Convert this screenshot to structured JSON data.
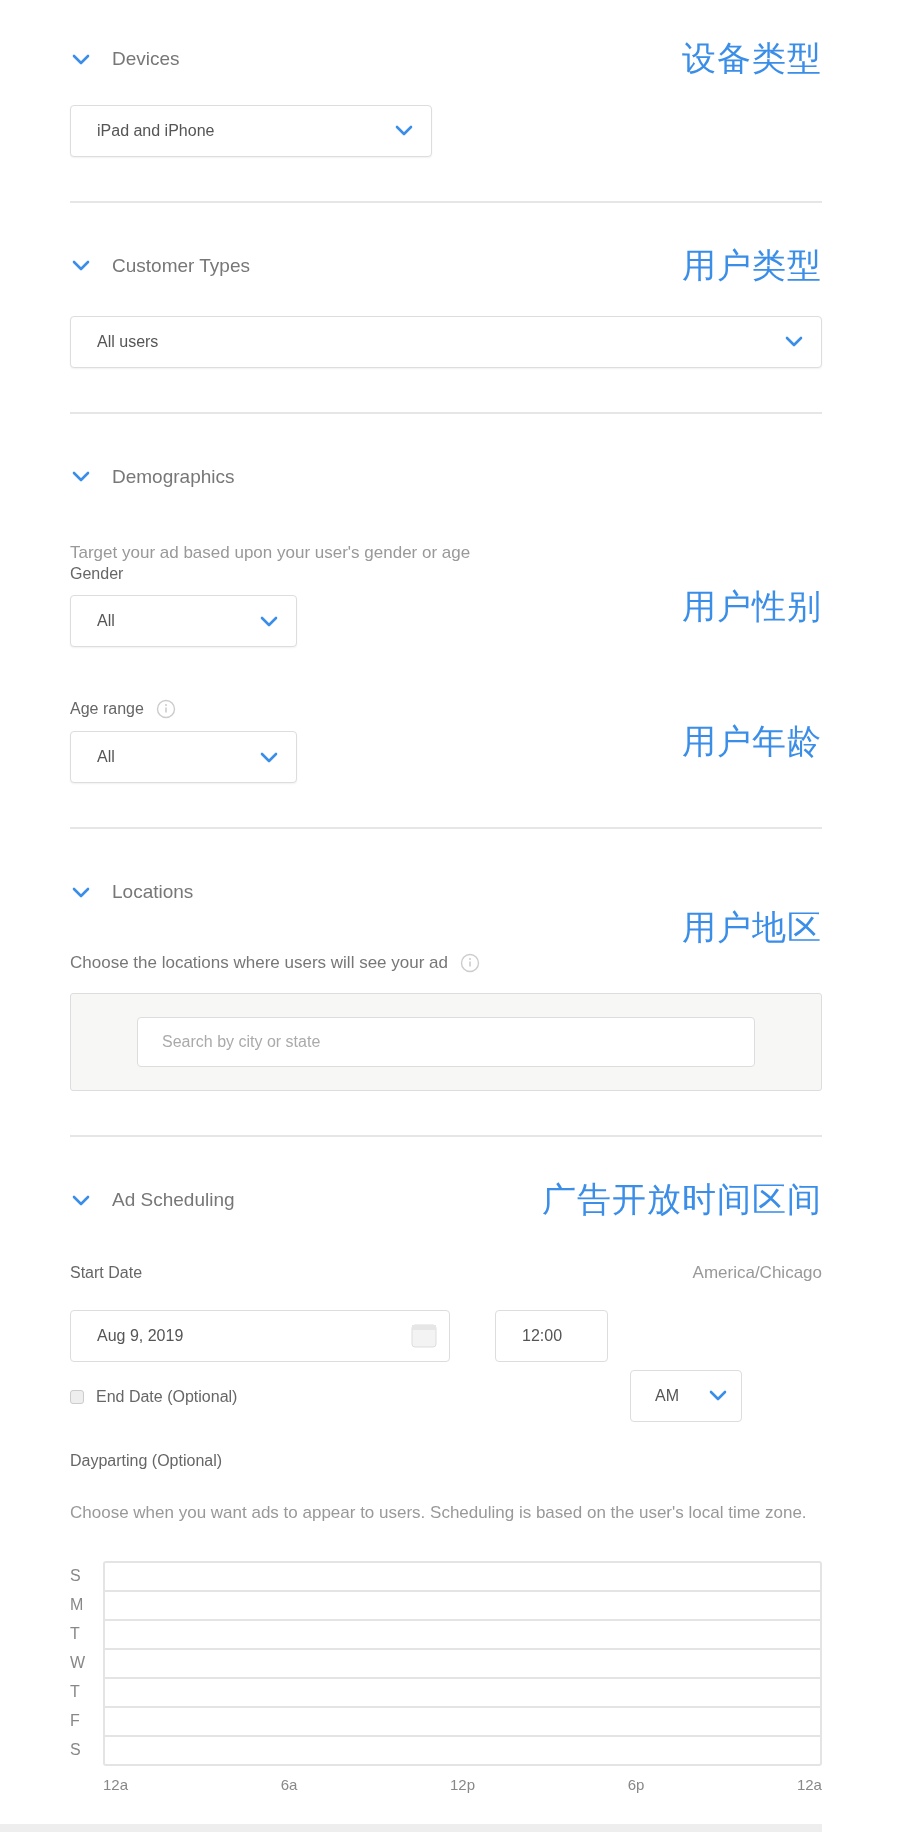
{
  "sections": [
    {
      "kind": "devices",
      "title": "Devices",
      "expanded": true,
      "annotation": "设备类型",
      "select": {
        "value": "iPad and iPhone"
      }
    },
    {
      "kind": "customer_types",
      "title": "Customer Types",
      "expanded": true,
      "annotation": "用户类型",
      "select": {
        "value": "All users"
      }
    },
    {
      "kind": "demographics",
      "title": "Demographics",
      "expanded": true,
      "description": "Target your ad based upon your user's gender or age",
      "gender": {
        "label": "Gender",
        "value": "All",
        "annotation": "用户性别"
      },
      "age": {
        "label": "Age range",
        "value": "All",
        "annotation": "用户年龄"
      }
    },
    {
      "kind": "locations",
      "title": "Locations",
      "expanded": true,
      "annotation": "用户地区",
      "description": "Choose the locations where users will see your ad",
      "search": {
        "placeholder": "Search by city or state"
      }
    },
    {
      "kind": "scheduling",
      "title": "Ad Scheduling",
      "expanded": true,
      "annotation": "广告开放时间区间",
      "start_label": "Start Date",
      "timezone": "America/Chicago",
      "date": "Aug 9, 2019",
      "time": "12:00",
      "meridiem": "AM",
      "end_date": {
        "label": "End Date (Optional)",
        "checked": false
      },
      "dayparting": {
        "label": "Dayparting (Optional)",
        "description": "Choose when you want ads to appear to users. Scheduling is based on the user's local time zone.",
        "days": [
          "S",
          "M",
          "T",
          "W",
          "T",
          "F",
          "S"
        ],
        "hours": [
          "12a",
          "6a",
          "12p",
          "6p",
          "12a"
        ]
      }
    }
  ]
}
